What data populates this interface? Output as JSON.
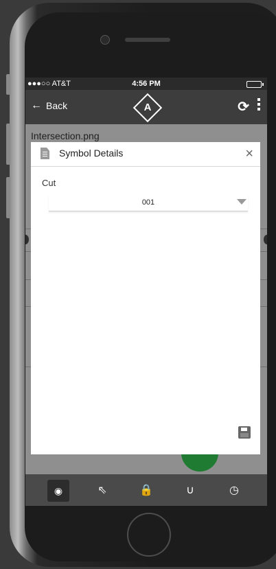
{
  "status": {
    "carrier": "●●●○○ AT&T",
    "time": "4:56 PM"
  },
  "nav": {
    "back_label": "Back",
    "back_icon": "←",
    "logo_text": "A",
    "refresh_icon": "⟳"
  },
  "file": {
    "name": "Intersection.png"
  },
  "dialog": {
    "title": "Symbol Details",
    "close_icon": "×",
    "field_label": "Cut",
    "select_value": "001"
  },
  "toolbar": {
    "tools": [
      {
        "name": "view",
        "icon": "◉",
        "active": true
      },
      {
        "name": "select",
        "icon": "⇖",
        "active": false
      },
      {
        "name": "lock",
        "icon": "🔒",
        "active": false
      },
      {
        "name": "magnet",
        "icon": "∪",
        "active": false
      },
      {
        "name": "history",
        "icon": "◷",
        "active": false
      }
    ]
  },
  "colors": {
    "accent_green": "#1f7a32",
    "nav_bg": "#3d3d3d",
    "toolbar_bg": "#4a4a4a"
  }
}
